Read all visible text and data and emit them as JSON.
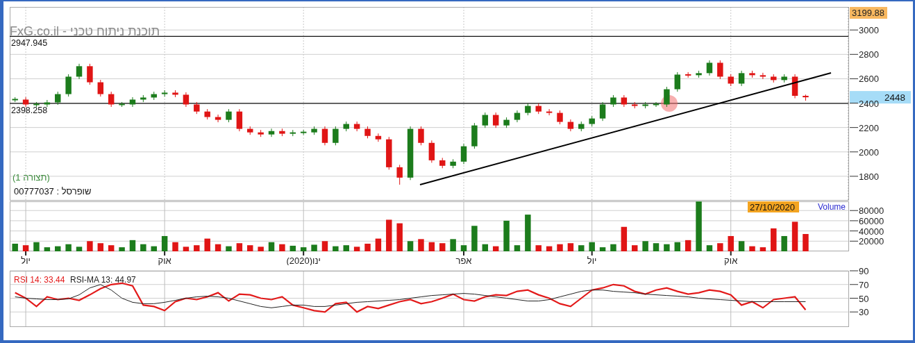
{
  "price_panel": {
    "app_title": "FxG.co.il - תוכנת ניתוח טכני",
    "setup_label": "(תצורה 1)",
    "symbol_label": "שופרסל : 00777037",
    "max_badge": "3199.88",
    "last_price_badge": "2448",
    "chart_data": {
      "type": "candlestick",
      "grid": true,
      "ylim": [
        1600,
        3189
      ],
      "yticks": [
        1800,
        2000,
        2200,
        2400,
        2600,
        2800,
        3000
      ],
      "categories": [
        null,
        null,
        null,
        null,
        null,
        null,
        null,
        null,
        null,
        null,
        null,
        null,
        null,
        null,
        null,
        null,
        null,
        null,
        null,
        null,
        null,
        null,
        null,
        null,
        null,
        null,
        null,
        null,
        null,
        null,
        null,
        null,
        null,
        null,
        null,
        null,
        null,
        null,
        null,
        null,
        null,
        null,
        null,
        null,
        null,
        null,
        null,
        null,
        null,
        null,
        null,
        null,
        null,
        null,
        null,
        null,
        null,
        null,
        null,
        null,
        null,
        null,
        null,
        null,
        null,
        null,
        null,
        null,
        null,
        null,
        null,
        null,
        null,
        null,
        null
      ],
      "ohlc": [
        [
          2429,
          2449,
          2409,
          2429
        ],
        [
          2429,
          2449,
          2369,
          2389
        ],
        [
          2389,
          2409,
          2369,
          2389
        ],
        [
          2389,
          2426,
          2369,
          2406
        ],
        [
          2406,
          2494,
          2386,
          2474
        ],
        [
          2474,
          2637,
          2454,
          2617
        ],
        [
          2617,
          2723,
          2597,
          2703
        ],
        [
          2703,
          2723,
          2551,
          2571
        ],
        [
          2571,
          2591,
          2454,
          2474
        ],
        [
          2474,
          2494,
          2369,
          2389
        ],
        [
          2389,
          2409,
          2369,
          2389
        ],
        [
          2389,
          2449,
          2369,
          2429
        ],
        [
          2429,
          2466,
          2409,
          2446
        ],
        [
          2446,
          2494,
          2426,
          2474
        ],
        [
          2474,
          2506,
          2454,
          2486
        ],
        [
          2486,
          2506,
          2449,
          2469
        ],
        [
          2469,
          2489,
          2369,
          2389
        ],
        [
          2389,
          2409,
          2311,
          2331
        ],
        [
          2331,
          2351,
          2266,
          2286
        ],
        [
          2286,
          2306,
          2243,
          2263
        ],
        [
          2263,
          2351,
          2243,
          2331
        ],
        [
          2331,
          2351,
          2169,
          2189
        ],
        [
          2189,
          2209,
          2140,
          2160
        ],
        [
          2160,
          2180,
          2123,
          2143
        ],
        [
          2143,
          2191,
          2123,
          2171
        ],
        [
          2171,
          2191,
          2129,
          2149
        ],
        [
          2149,
          2180,
          2129,
          2160
        ],
        [
          2160,
          2180,
          2140,
          2160
        ],
        [
          2160,
          2209,
          2140,
          2189
        ],
        [
          2189,
          2209,
          2054,
          2074
        ],
        [
          2074,
          2209,
          2054,
          2189
        ],
        [
          2189,
          2249,
          2169,
          2229
        ],
        [
          2229,
          2249,
          2169,
          2189
        ],
        [
          2189,
          2209,
          2111,
          2131
        ],
        [
          2131,
          2151,
          2083,
          2103
        ],
        [
          2103,
          2123,
          1854,
          1874
        ],
        [
          1874,
          1894,
          1731,
          1789
        ],
        [
          1789,
          2209,
          1769,
          2189
        ],
        [
          2189,
          2209,
          2054,
          2074
        ],
        [
          2074,
          2094,
          1911,
          1931
        ],
        [
          1931,
          1951,
          1866,
          1886
        ],
        [
          1886,
          1940,
          1866,
          1920
        ],
        [
          1920,
          2066,
          1900,
          2046
        ],
        [
          2046,
          2237,
          2026,
          2217
        ],
        [
          2217,
          2323,
          2197,
          2303
        ],
        [
          2303,
          2323,
          2197,
          2217
        ],
        [
          2217,
          2283,
          2197,
          2263
        ],
        [
          2263,
          2340,
          2243,
          2320
        ],
        [
          2320,
          2397,
          2300,
          2377
        ],
        [
          2377,
          2397,
          2311,
          2331
        ],
        [
          2331,
          2351,
          2300,
          2320
        ],
        [
          2320,
          2340,
          2226,
          2246
        ],
        [
          2246,
          2266,
          2169,
          2189
        ],
        [
          2189,
          2249,
          2169,
          2229
        ],
        [
          2229,
          2294,
          2209,
          2274
        ],
        [
          2274,
          2409,
          2254,
          2389
        ],
        [
          2389,
          2466,
          2369,
          2446
        ],
        [
          2446,
          2466,
          2369,
          2389
        ],
        [
          2389,
          2409,
          2357,
          2377
        ],
        [
          2377,
          2409,
          2357,
          2389
        ],
        [
          2389,
          2409,
          2369,
          2389
        ],
        [
          2389,
          2534,
          2369,
          2514
        ],
        [
          2514,
          2654,
          2494,
          2634
        ],
        [
          2634,
          2654,
          2609,
          2629
        ],
        [
          2629,
          2666,
          2609,
          2646
        ],
        [
          2646,
          2751,
          2626,
          2731
        ],
        [
          2731,
          2751,
          2597,
          2617
        ],
        [
          2617,
          2637,
          2540,
          2560
        ],
        [
          2560,
          2666,
          2540,
          2646
        ],
        [
          2646,
          2666,
          2609,
          2629
        ],
        [
          2629,
          2649,
          2597,
          2617
        ],
        [
          2617,
          2637,
          2569,
          2589
        ],
        [
          2589,
          2637,
          2569,
          2617
        ],
        [
          2617,
          2637,
          2440,
          2460
        ],
        [
          2460,
          2470,
          2420,
          2448
        ]
      ],
      "ref_lines": [
        {
          "axis": "y",
          "value": 2947.945,
          "label": "2947.945"
        },
        {
          "axis": "y",
          "value": 2398.258,
          "label": "2398.258"
        }
      ]
    }
  },
  "volume_panel": {
    "date_badge": "27/10/2020",
    "chart_data": {
      "type": "bar",
      "grid": true,
      "ylim": [
        0,
        98000
      ],
      "yticks": [
        20000,
        40000,
        60000,
        80000
      ],
      "categories": [
        null,
        "יול",
        null,
        null,
        null,
        null,
        null,
        null,
        null,
        null,
        null,
        null,
        null,
        null,
        "אוק",
        null,
        null,
        null,
        null,
        null,
        null,
        null,
        null,
        null,
        null,
        null,
        null,
        "ינו(2020)",
        null,
        null,
        null,
        null,
        null,
        null,
        null,
        null,
        null,
        null,
        null,
        null,
        null,
        null,
        "אפר",
        null,
        null,
        null,
        null,
        null,
        null,
        null,
        null,
        null,
        null,
        null,
        "יול",
        null,
        null,
        null,
        null,
        null,
        null,
        null,
        null,
        null,
        null,
        null,
        null,
        "אוק",
        null,
        null,
        null,
        null,
        null,
        null,
        null
      ],
      "series": [
        {
          "name": "Volume",
          "values": [
            15000,
            12000,
            18000,
            8000,
            10000,
            14000,
            9000,
            20000,
            16000,
            12000,
            8000,
            22000,
            14000,
            10000,
            30000,
            18000,
            9000,
            12000,
            25000,
            14000,
            10000,
            16000,
            12000,
            9000,
            18000,
            14000,
            11000,
            8000,
            13000,
            20000,
            10000,
            12000,
            9000,
            15000,
            25000,
            62000,
            55000,
            20000,
            24000,
            18000,
            16000,
            24000,
            12000,
            50000,
            14000,
            10000,
            60000,
            12000,
            72000,
            12000,
            10000,
            14000,
            16000,
            12000,
            18000,
            8000,
            14000,
            48000,
            12000,
            20000,
            16000,
            14000,
            18000,
            22000,
            98000,
            12000,
            16000,
            30000,
            20000,
            10000,
            8000,
            45000,
            30000,
            58000,
            34000
          ]
        }
      ]
    }
  },
  "rsi_panel": {
    "rsi_reading": ": 33.44",
    "ma_reading": ": 44.97",
    "chart_data": {
      "type": "line",
      "grid": true,
      "ylim": [
        8,
        90
      ],
      "yticks": [
        30,
        50,
        70,
        90
      ],
      "categories": [
        null,
        null,
        null,
        null,
        null,
        null,
        null,
        null,
        null,
        null,
        null,
        null,
        null,
        null,
        null,
        null,
        null,
        null,
        null,
        null,
        null,
        null,
        null,
        null,
        null,
        null,
        null,
        null,
        null,
        null,
        null,
        null,
        null,
        null,
        null,
        null,
        null,
        null,
        null,
        null,
        null,
        null,
        null,
        null,
        null,
        null,
        null,
        null,
        null,
        null,
        null,
        null,
        null,
        null,
        null,
        null,
        null,
        null,
        null,
        null,
        null,
        null,
        null,
        null,
        null,
        null,
        null,
        null,
        null,
        null,
        null,
        null,
        null,
        null,
        null
      ],
      "series": [
        {
          "name": "RSI 14",
          "color": "#e31a1a",
          "values": [
            58,
            50,
            38,
            52,
            48,
            50,
            47,
            55,
            64,
            70,
            72,
            68,
            40,
            38,
            32,
            45,
            50,
            48,
            52,
            58,
            46,
            56,
            55,
            50,
            48,
            52,
            40,
            36,
            32,
            30,
            42,
            44,
            30,
            38,
            35,
            40,
            45,
            48,
            42,
            45,
            50,
            56,
            48,
            46,
            52,
            55,
            54,
            60,
            62,
            55,
            50,
            42,
            38,
            50,
            62,
            65,
            70,
            68,
            60,
            56,
            62,
            65,
            60,
            56,
            58,
            62,
            60,
            55,
            40,
            45,
            36,
            48,
            50,
            52,
            33
          ]
        },
        {
          "name": "RSI-MA 13",
          "color": "#222222",
          "values": [
            52,
            50,
            49,
            48,
            48,
            49,
            55,
            65,
            70,
            62,
            50,
            44,
            42,
            42,
            44,
            47,
            50,
            52,
            53,
            52,
            50,
            46,
            42,
            38,
            36,
            38,
            40,
            40,
            38,
            38,
            40,
            42,
            44,
            45,
            46,
            47,
            48,
            50,
            52,
            54,
            55,
            56,
            57,
            56,
            54,
            52,
            50,
            48,
            46,
            46,
            48,
            52,
            56,
            60,
            62,
            62,
            60,
            59,
            58,
            56,
            55,
            54,
            53,
            52,
            50,
            49,
            48,
            47,
            46,
            45,
            45,
            45,
            45,
            45,
            45
          ]
        }
      ]
    }
  }
}
